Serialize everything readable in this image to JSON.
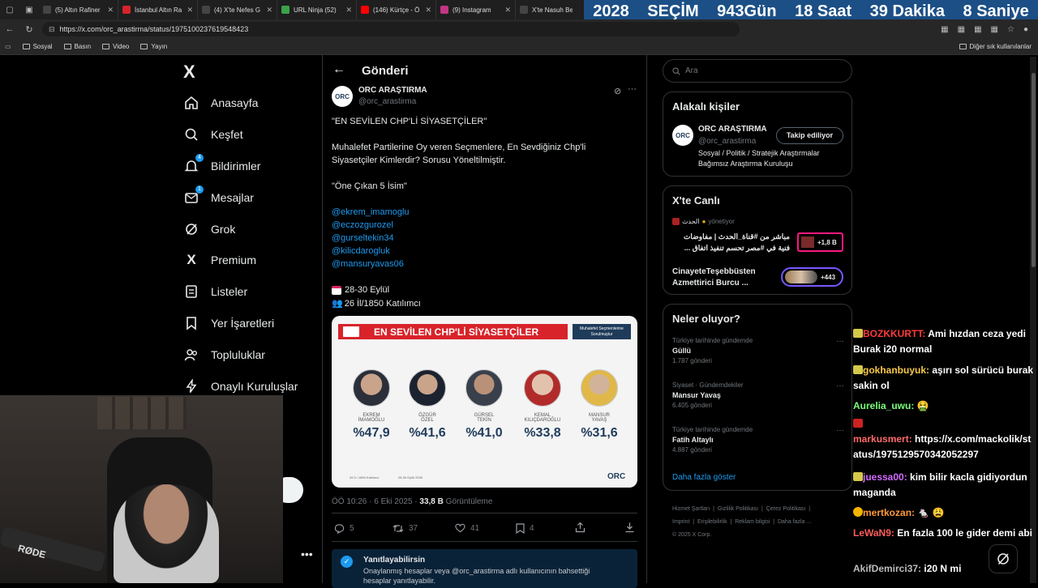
{
  "browser": {
    "tabs": [
      {
        "label": "(5) Altın Rafiner",
        "color": "#444"
      },
      {
        "label": "İstanbul Altın Ra",
        "color": "#d8232a"
      },
      {
        "label": "(4) X'te Nefes G",
        "color": "#444"
      },
      {
        "label": "URL Ninja (52)",
        "color": "#3aa24a"
      },
      {
        "label": "(146) Kürtçe - Ö",
        "color": "#ff0000"
      },
      {
        "label": "(9) Instagram",
        "color": "#c13584"
      },
      {
        "label": "X'te Nasuh Be",
        "color": "#444"
      }
    ],
    "url": "https://x.com/orc_arastirma/status/1975100237619548423",
    "bookmarks": [
      "Sosyal",
      "Basın",
      "Video",
      "Yayın"
    ],
    "other_bookmarks": "Diğer sık kullanılanlar"
  },
  "countdown": {
    "year": "2028",
    "title": "SEÇİM",
    "days": "943",
    "days_label": "Gün",
    "hours": "18",
    "hours_label": "Saat",
    "minutes": "39",
    "minutes_label": "Dakika",
    "seconds": "8",
    "seconds_label": "Saniye"
  },
  "nav": {
    "logo": "X",
    "items": [
      "Anasayfa",
      "Keşfet",
      "Bildirimler",
      "Mesajlar",
      "Grok",
      "Premium",
      "Listeler",
      "Yer İşaretleri",
      "Topluluklar",
      "Onaylı Kuruluşlar"
    ],
    "notif_badge": "4",
    "msg_badge": "1"
  },
  "post": {
    "header": "Gönderi",
    "author": "ORC ARAŞTIRMA",
    "handle": "@orc_arastirma",
    "line1": "\"EN SEVİLEN CHP'Lİ SİYASETÇİLER\"",
    "line2a": "Muhalefet Partilerine Oy veren Seçmenlere, En Sevdiğiniz Chp'li",
    "line2b": "Siyasetçiler Kimlerdir? Sorusu Yöneltilmiştir.",
    "line3": "\"Öne Çıkan 5 İsim\"",
    "mentions": [
      "@ekrem_imamoglu",
      "@eczozgurozel",
      "@gurseltekin34",
      "@kilicdarogluk",
      "@mansuryavas06"
    ],
    "date_line": "28-30 Eylül",
    "sample_line": "26 İl/1850 Katılımcı",
    "timestamp": "ÖÖ 10:26 · 6 Eki 2025 · ",
    "views": "33,8 B",
    "views_label": "Görüntüleme",
    "replies": "5",
    "retweets": "37",
    "likes": "41",
    "bookmarks": "4",
    "reply_title": "Yanıtlayabilirsin",
    "reply_text": "Onaylanmış hesaplar veya @orc_arastirma adlı kullanıcının bahsettiği",
    "reply_text2": "hesaplar yanıtlayabilir."
  },
  "infographic": {
    "title": "EN SEVİLEN CHP'Lİ SİYASETÇİLER",
    "subtitle": "Muhalefet Seçmenlerine Sorulmuştur",
    "people": [
      {
        "name1": "EKREM",
        "name2": "İMAMOĞLU",
        "pct": "%47,9"
      },
      {
        "name1": "ÖZGÜR",
        "name2": "ÖZEL",
        "pct": "%41,6"
      },
      {
        "name1": "GÜRSEL",
        "name2": "TEKİN",
        "pct": "%41,0"
      },
      {
        "name1": "KEMAL",
        "name2": "KILIÇDAROĞLU",
        "pct": "%33,8"
      },
      {
        "name1": "MANSUR",
        "name2": "YAVAŞ",
        "pct": "%31,6"
      }
    ],
    "foot1": "26 İl / 1850 Katılımcı",
    "foot2": "28-30 Eylül 2025",
    "brand": "ORC"
  },
  "right": {
    "search_placeholder": "Ara",
    "related_title": "Alakalı kişiler",
    "related_name": "ORC ARAŞTIRMA",
    "related_handle": "@orc_arastirma",
    "follow_btn": "Takip ediliyor",
    "related_bio1": "Sosyal / Politik / Stratejik Araştırmalar",
    "related_bio2": "Bağımsız Araştırma Kuruluşu",
    "live_title": "X'te Canlı",
    "live1_host": "الحدث",
    "live1_host_label": "yönetiyor",
    "live1_line1": "مباشر من #قناة_الحدث | مفاوضات",
    "live1_line2": "فنية في #مصر تحسم تنفيذ اتفاق ...",
    "live1_count": "+1,8 B",
    "live2_line1": "CinayeteTeşebbüsten",
    "live2_line2": "Azmettirici Burcu ...",
    "live2_count": "+443",
    "trends_title": "Neler oluyor?",
    "trends": [
      {
        "context": "Türkiye tarihinde gündemde",
        "name": "Güllü",
        "count": "1.787 gönderi"
      },
      {
        "context": "Siyaset · Gündemdekiler",
        "name": "Mansur Yavaş",
        "count": "6.405 gönderi"
      },
      {
        "context": "Türkiye tarihinde gündemde",
        "name": "Fatih Altaylı",
        "count": "4.887 gönderi"
      }
    ],
    "show_more": "Daha fazla göster",
    "footer1": [
      "Hizmet Şartları",
      "Gizlilik Politikası",
      "Çerez Politikası"
    ],
    "footer2": [
      "Imprint",
      "Erişilebilirlik",
      "Reklam bilgisi",
      "Daha fazla ..."
    ],
    "copyright": "© 2025 X Corp."
  },
  "chat": [
    {
      "user": "BOZKKURTT:",
      "color": "#ff3b3b",
      "text": "Ami hızdan ceza yedi Burak i20 normal"
    },
    {
      "user": "gokhanbuyuk:",
      "color": "#f7c948",
      "text": "aşırı sol sürücü burak sakin ol"
    },
    {
      "user": "Aurelia_uwu:",
      "color": "#7cfc7c",
      "text": "🤮"
    },
    {
      "user": "markusmert:",
      "color": "#ff6b6b",
      "text": "https://x.com/mackolik/status/1975129570342052297"
    },
    {
      "user": "juessa00:",
      "color": "#d36bff",
      "text": "kim bilir kacla gidiyordun maganda"
    },
    {
      "user": "mertkozan:",
      "color": "#ff9a3b",
      "text": "🐁 😩"
    },
    {
      "user": "LeWaN9:",
      "color": "#ff5c5c",
      "text": "En fazla 100 le gider demi abi"
    },
    {
      "user": "AkifDemirci37:",
      "color": "#bdbdbd",
      "text": "i20 N mi"
    }
  ],
  "colors": {
    "accent": "#1d9bf0",
    "infographic_red": "#d8232a",
    "infographic_navy": "#1f3b5a"
  }
}
